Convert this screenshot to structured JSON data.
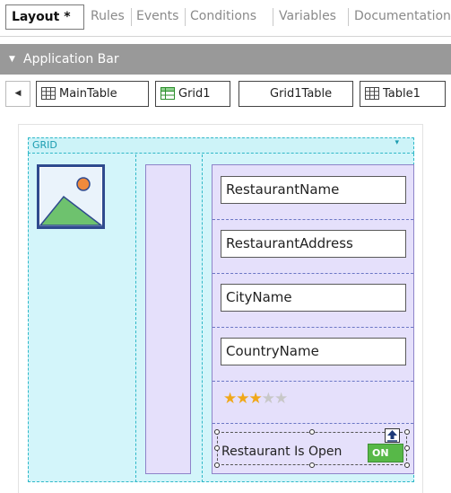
{
  "tabs": {
    "active": "Layout *",
    "items": [
      "Rules",
      "Events",
      "Conditions",
      "Variables",
      "Documentation"
    ]
  },
  "app_bar": {
    "label": "Application Bar"
  },
  "breadcrumb": {
    "items": [
      {
        "label": "MainTable",
        "icon": "table-icon"
      },
      {
        "label": "Grid1",
        "icon": "grid-icon"
      },
      {
        "label": "Grid1Table",
        "icon": ""
      },
      {
        "label": "Table1",
        "icon": "table-icon"
      }
    ]
  },
  "grid": {
    "label": "GRID"
  },
  "fields": [
    "RestaurantName",
    "RestaurantAddress",
    "CityName",
    "CountryName"
  ],
  "rating": {
    "value": 3,
    "max": 5
  },
  "switch_row": {
    "label": "Restaurant Is Open",
    "switch_text": "ON",
    "state": "on"
  },
  "colors": {
    "grid_bg": "#d3f5fa",
    "grid_border": "#2fb8c8",
    "table_bg": "#e5e0fb",
    "table_border": "#8e83c9",
    "switch_on": "#57b848",
    "star_on": "#f0a81a",
    "app_bar": "#999999"
  }
}
